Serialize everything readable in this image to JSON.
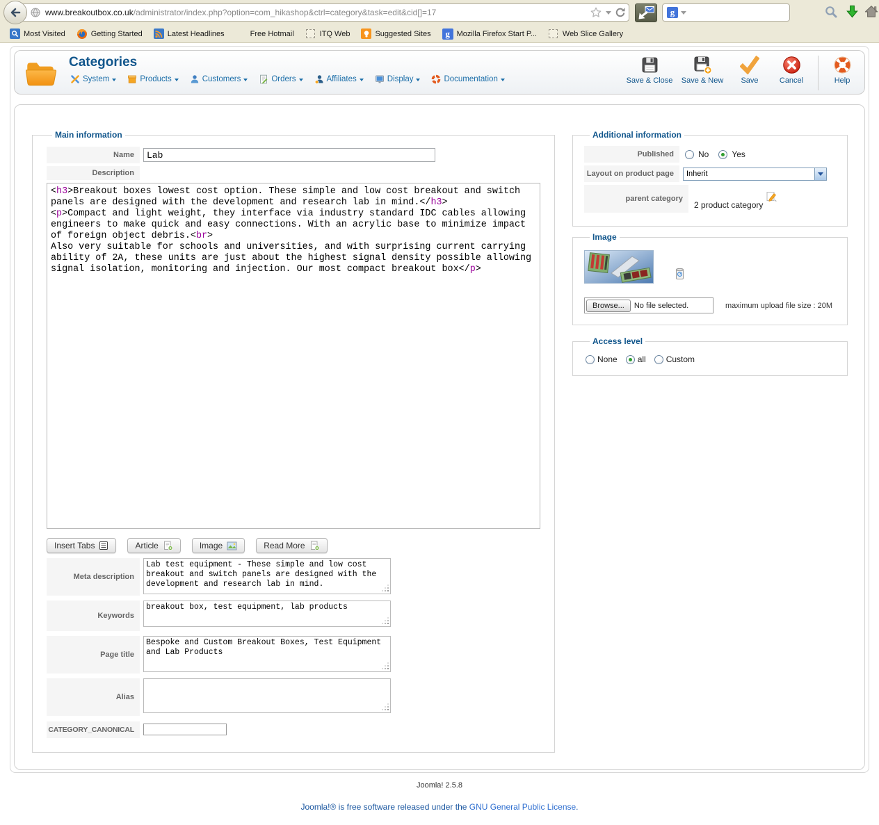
{
  "colors": {
    "accent_blue": "#11568c",
    "menu_blue": "#1a6da8",
    "tag_magenta": "#990099",
    "link_blue": "#2f6fd0",
    "chrome_beige": "#ece9d8"
  },
  "browser": {
    "url_host": "www.breakoutbox.co.uk",
    "url_path": "/administrator/index.php?option=com_hikashop&ctrl=category&task=edit&cid[]=17",
    "search_engine_letter": "g",
    "bookmarks": [
      "Most Visited",
      "Getting Started",
      "Latest Headlines",
      "Free Hotmail",
      "ITQ Web",
      "Suggested Sites",
      "Mozilla Firefox Start P...",
      "Web Slice Gallery"
    ]
  },
  "toolbar": {
    "title": "Categories",
    "menus": [
      {
        "label": "System"
      },
      {
        "label": "Products"
      },
      {
        "label": "Customers"
      },
      {
        "label": "Orders"
      },
      {
        "label": "Affiliates"
      },
      {
        "label": "Display"
      },
      {
        "label": "Documentation"
      }
    ],
    "actions": {
      "save_close": "Save & Close",
      "save_new": "Save & New",
      "save": "Save",
      "cancel": "Cancel",
      "help": "Help"
    }
  },
  "main": {
    "legend": "Main information",
    "name": {
      "label": "Name",
      "value": "Lab"
    },
    "description": {
      "label": "Description",
      "value": "<h3>Breakout boxes lowest cost option. These simple and low cost breakout and switch panels are designed with the development and research lab in mind.</h3>\n<p>Compact and light weight, they interface via industry standard IDC cables allowing engineers to make quick and easy connections. With an acrylic base to minimize impact of foreign object debris.<br>\nAlso very suitable for schools and universities, and with surprising current carrying ability of 2A, these units are just about the highest signal density possible allowing signal isolation, monitoring and injection. Our most compact breakout box</p>"
    },
    "editor_buttons": [
      {
        "label": "Insert Tabs"
      },
      {
        "label": "Article"
      },
      {
        "label": "Image"
      },
      {
        "label": "Read More"
      }
    ],
    "meta_description": {
      "label": "Meta description",
      "value": "Lab test equipment - These simple and low cost breakout and switch panels are designed with the development and research lab in mind."
    },
    "keywords": {
      "label": "Keywords",
      "value": "breakout box, test equipment, lab products"
    },
    "page_title": {
      "label": "Page title",
      "value": "Bespoke and Custom Breakout Boxes, Test Equipment and Lab Products"
    },
    "alias": {
      "label": "Alias",
      "value": ""
    },
    "category_canonical": {
      "label": "CATEGORY_CANONICAL",
      "value": ""
    }
  },
  "additional": {
    "legend": "Additional information",
    "published": {
      "label": "Published",
      "options": [
        "No",
        "Yes"
      ],
      "selected": "Yes"
    },
    "layout": {
      "label": "Layout on product page",
      "value": "Inherit"
    },
    "parent": {
      "label": "parent category",
      "value": "2 product category"
    }
  },
  "image_panel": {
    "legend": "Image",
    "browse_label": "Browse...",
    "file_status": "No file selected.",
    "max_note": "maximum upload file size : 20M"
  },
  "access": {
    "legend": "Access level",
    "options": [
      "None",
      "all",
      "Custom"
    ],
    "selected": "all"
  },
  "footer": {
    "version": "Joomla! 2.5.8",
    "license_prefix": "Joomla!® is free software released under the ",
    "license_link": "GNU General Public License",
    "license_suffix": "."
  }
}
